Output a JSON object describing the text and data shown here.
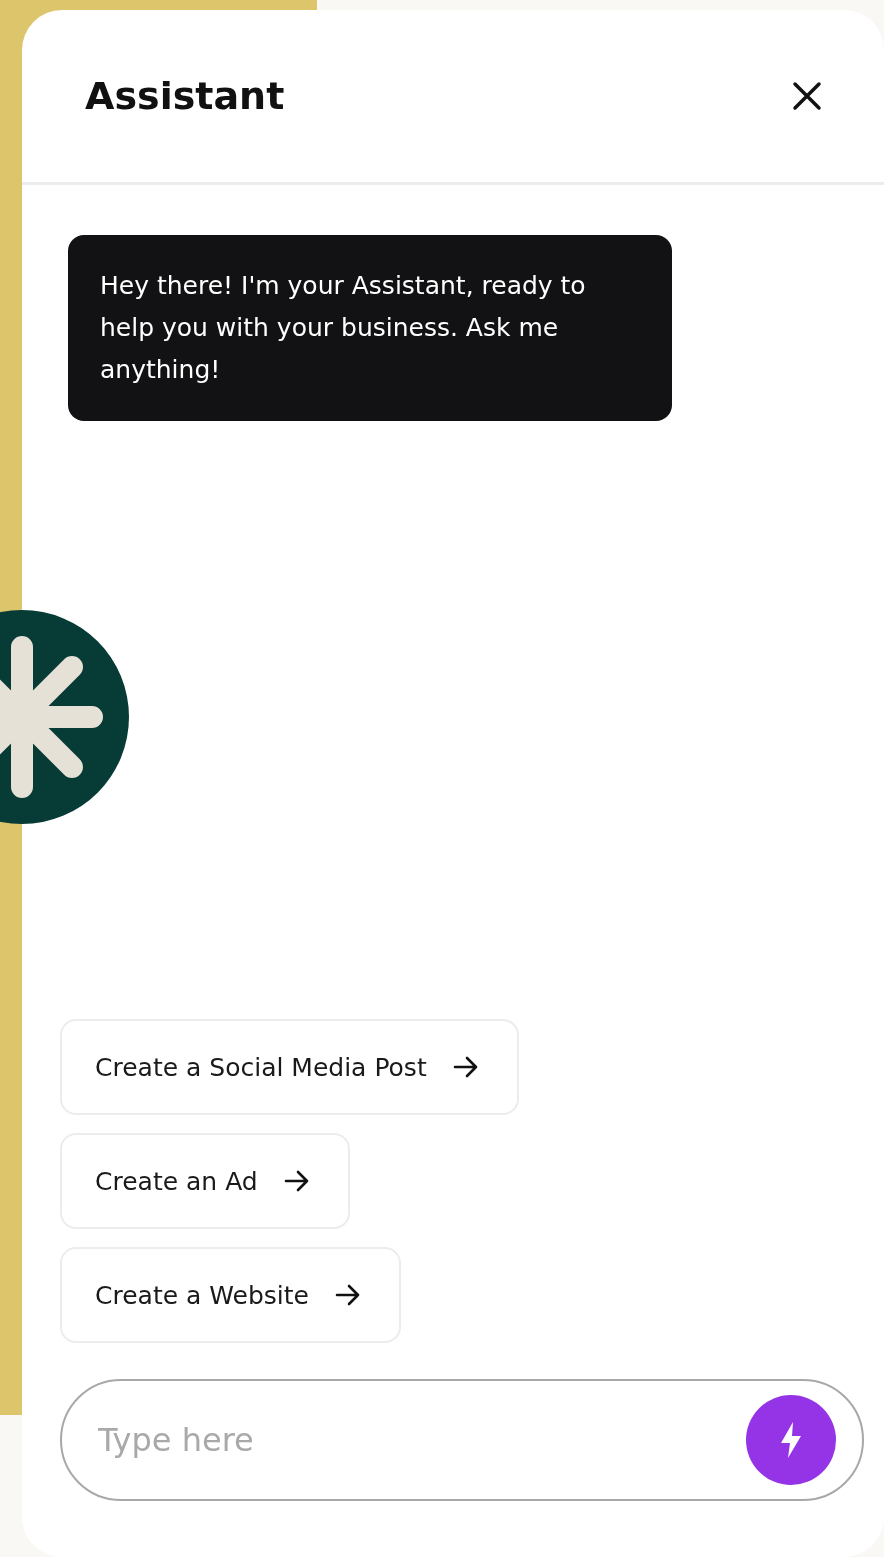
{
  "panel": {
    "title": "Assistant"
  },
  "messages": [
    {
      "text": "Hey there! I'm your Assistant, ready to help you with your business. Ask me anything!"
    }
  ],
  "suggestions": [
    {
      "label": "Create a Social Media Post"
    },
    {
      "label": "Create an Ad"
    },
    {
      "label": "Create a Website"
    }
  ],
  "composer": {
    "placeholder": "Type here"
  }
}
